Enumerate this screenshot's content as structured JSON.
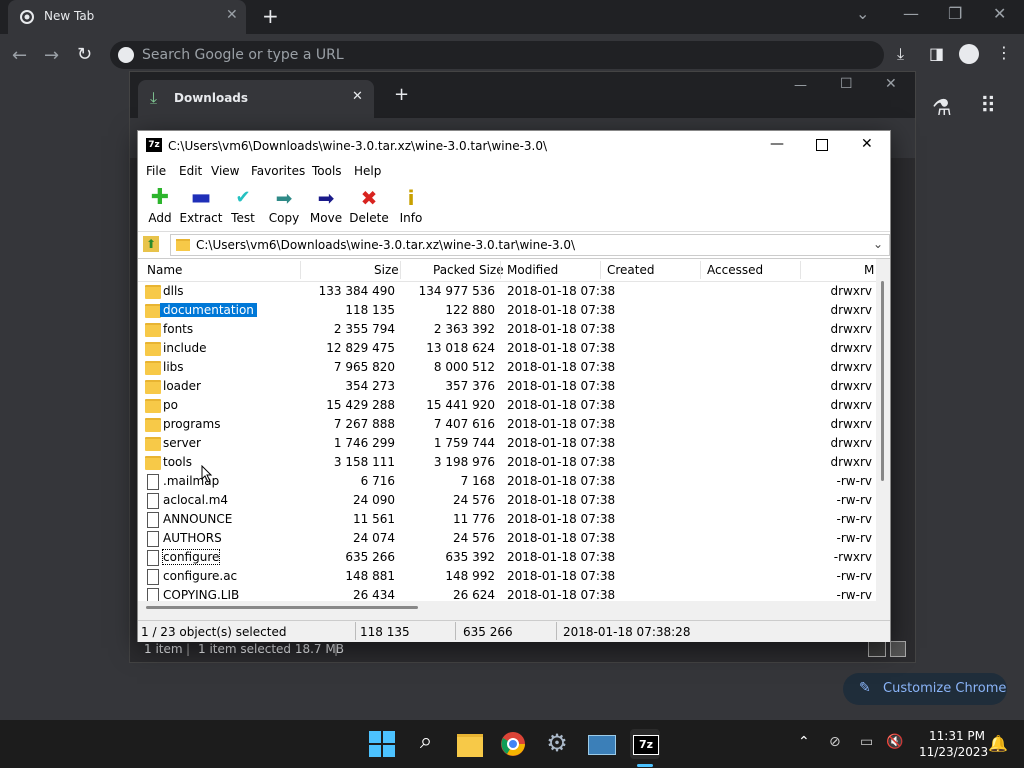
{
  "chrome": {
    "tab_title": "New Tab",
    "omnibox_placeholder": "Search Google or type a URL",
    "customize_label": "Customize Chrome"
  },
  "downloads": {
    "tab_title": "Downloads",
    "status": {
      "items": "1 item",
      "selected": "1 item selected 18.7 MB"
    }
  },
  "zip": {
    "title": "C:\\Users\\vm6\\Downloads\\wine-3.0.tar.xz\\wine-3.0.tar\\wine-3.0\\",
    "menu": [
      "File",
      "Edit",
      "View",
      "Favorites",
      "Tools",
      "Help"
    ],
    "toolbar": [
      "Add",
      "Extract",
      "Test",
      "Copy",
      "Move",
      "Delete",
      "Info"
    ],
    "address": "C:\\Users\\vm6\\Downloads\\wine-3.0.tar.xz\\wine-3.0.tar\\wine-3.0\\",
    "columns": [
      "Name",
      "Size",
      "Packed Size",
      "Modified",
      "Created",
      "Accessed",
      "M"
    ],
    "rows": [
      {
        "type": "folder",
        "name": "dlls",
        "size": "133 384 490",
        "packed": "134 977 536",
        "modified": "2018-01-18 07:38",
        "mode": "drwxrv"
      },
      {
        "type": "folder",
        "name": "documentation",
        "size": "118 135",
        "packed": "122 880",
        "modified": "2018-01-18 07:38",
        "mode": "drwxrv"
      },
      {
        "type": "folder",
        "name": "fonts",
        "size": "2 355 794",
        "packed": "2 363 392",
        "modified": "2018-01-18 07:38",
        "mode": "drwxrv"
      },
      {
        "type": "folder",
        "name": "include",
        "size": "12 829 475",
        "packed": "13 018 624",
        "modified": "2018-01-18 07:38",
        "mode": "drwxrv"
      },
      {
        "type": "folder",
        "name": "libs",
        "size": "7 965 820",
        "packed": "8 000 512",
        "modified": "2018-01-18 07:38",
        "mode": "drwxrv"
      },
      {
        "type": "folder",
        "name": "loader",
        "size": "354 273",
        "packed": "357 376",
        "modified": "2018-01-18 07:38",
        "mode": "drwxrv"
      },
      {
        "type": "folder",
        "name": "po",
        "size": "15 429 288",
        "packed": "15 441 920",
        "modified": "2018-01-18 07:38",
        "mode": "drwxrv"
      },
      {
        "type": "folder",
        "name": "programs",
        "size": "7 267 888",
        "packed": "7 407 616",
        "modified": "2018-01-18 07:38",
        "mode": "drwxrv"
      },
      {
        "type": "folder",
        "name": "server",
        "size": "1 746 299",
        "packed": "1 759 744",
        "modified": "2018-01-18 07:38",
        "mode": "drwxrv"
      },
      {
        "type": "folder",
        "name": "tools",
        "size": "3 158 111",
        "packed": "3 198 976",
        "modified": "2018-01-18 07:38",
        "mode": "drwxrv"
      },
      {
        "type": "file",
        "name": ".mailmap",
        "size": "6 716",
        "packed": "7 168",
        "modified": "2018-01-18 07:38",
        "mode": "-rw-rv"
      },
      {
        "type": "file",
        "name": "aclocal.m4",
        "size": "24 090",
        "packed": "24 576",
        "modified": "2018-01-18 07:38",
        "mode": "-rw-rv"
      },
      {
        "type": "file",
        "name": "ANNOUNCE",
        "size": "11 561",
        "packed": "11 776",
        "modified": "2018-01-18 07:38",
        "mode": "-rw-rv"
      },
      {
        "type": "file",
        "name": "AUTHORS",
        "size": "24 074",
        "packed": "24 576",
        "modified": "2018-01-18 07:38",
        "mode": "-rw-rv"
      },
      {
        "type": "file",
        "name": "configure",
        "size": "635 266",
        "packed": "635 392",
        "modified": "2018-01-18 07:38",
        "mode": "-rwxrv"
      },
      {
        "type": "file",
        "name": "configure.ac",
        "size": "148 881",
        "packed": "148 992",
        "modified": "2018-01-18 07:38",
        "mode": "-rw-rv"
      },
      {
        "type": "file",
        "name": "COPYING.LIB",
        "size": "26 434",
        "packed": "26 624",
        "modified": "2018-01-18 07:38",
        "mode": "-rw-rv"
      }
    ],
    "status": {
      "selected": "1 / 23 object(s) selected",
      "size": "118 135",
      "packed": "635 266",
      "modified": "2018-01-18 07:38:28"
    }
  },
  "taskbar": {
    "time": "11:31 PM",
    "date": "11/23/2023"
  }
}
